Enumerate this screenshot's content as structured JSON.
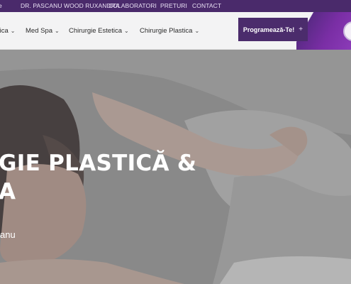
{
  "topbar": {
    "items": [
      "e",
      "DR. PASCANU WOOD RUXANDRA",
      "COLABORATORI",
      "PRETURI",
      "CONTACT"
    ]
  },
  "nav": {
    "items": [
      {
        "label": "tica",
        "chevron": "⌄"
      },
      {
        "label": "Med Spa",
        "chevron": "⌄"
      },
      {
        "label": "Chirurgie Estetica",
        "chevron": "⌄"
      },
      {
        "label": "Chirurgie Plastica",
        "chevron": "⌄"
      }
    ],
    "cta_label": "Programează-Te!",
    "cta_icon": "+"
  },
  "hero": {
    "title_line1": "GIE PLASTICĂ &",
    "title_line2": "A",
    "subtitle": "anu"
  },
  "colors": {
    "topbar": "#4a2a6b",
    "cta": "#4b2c6c",
    "accent": "#7a2ea5"
  }
}
